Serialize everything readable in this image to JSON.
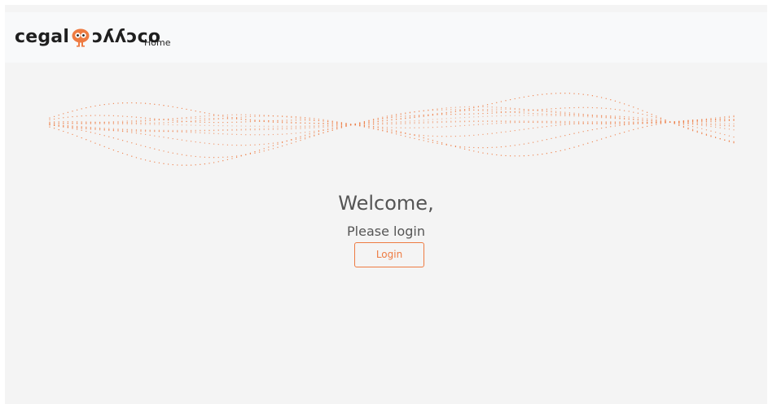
{
  "brand": {
    "left_text": "cegal",
    "right_text": "ɔʎʎɔco",
    "logo_icon": "owl-logo-icon",
    "accent_color": "#ee7b42"
  },
  "nav": {
    "home_label": "Home"
  },
  "main": {
    "heading": "Welcome,",
    "subheading": "Please login",
    "login_label": "Login"
  }
}
